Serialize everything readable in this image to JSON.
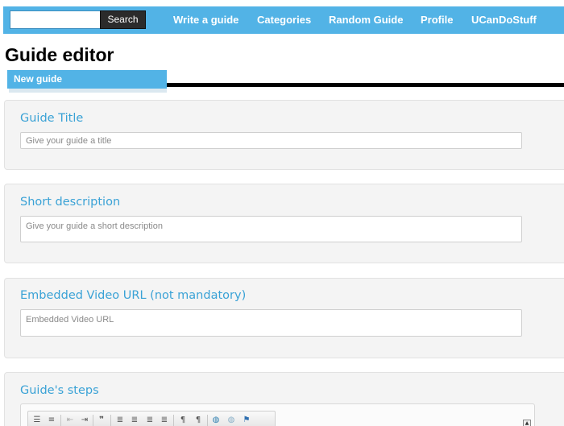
{
  "header": {
    "search": {
      "placeholder": "",
      "button_label": "Search"
    },
    "nav": [
      {
        "label": "Write a guide"
      },
      {
        "label": "Categories"
      },
      {
        "label": "Random Guide"
      },
      {
        "label": "Profile"
      },
      {
        "label": "UCanDoStuff"
      }
    ]
  },
  "page": {
    "title": "Guide editor",
    "tab_label": "New guide"
  },
  "form": {
    "guide_title": {
      "label": "Guide Title",
      "placeholder": "Give your guide a title"
    },
    "short_description": {
      "label": "Short description",
      "placeholder": "Give your guide a short description"
    },
    "video_url": {
      "label": "Embedded Video URL (not mandatory)",
      "placeholder": "Embedded Video URL"
    },
    "steps": {
      "label": "Guide's steps"
    }
  },
  "toolbar_icons": [
    "numbered-list-icon",
    "bulleted-list-icon",
    "outdent-icon",
    "indent-icon",
    "blockquote-icon",
    "align-left-icon",
    "align-center-icon",
    "align-right-icon",
    "justify-icon",
    "ltr-icon",
    "rtl-icon",
    "link-icon",
    "unlink-icon",
    "anchor-flag-icon"
  ],
  "colors": {
    "accent": "#52b3e6",
    "label": "#3aa2d6",
    "search_button": "#2b2b2b",
    "card_background": "#f4f4f4"
  }
}
